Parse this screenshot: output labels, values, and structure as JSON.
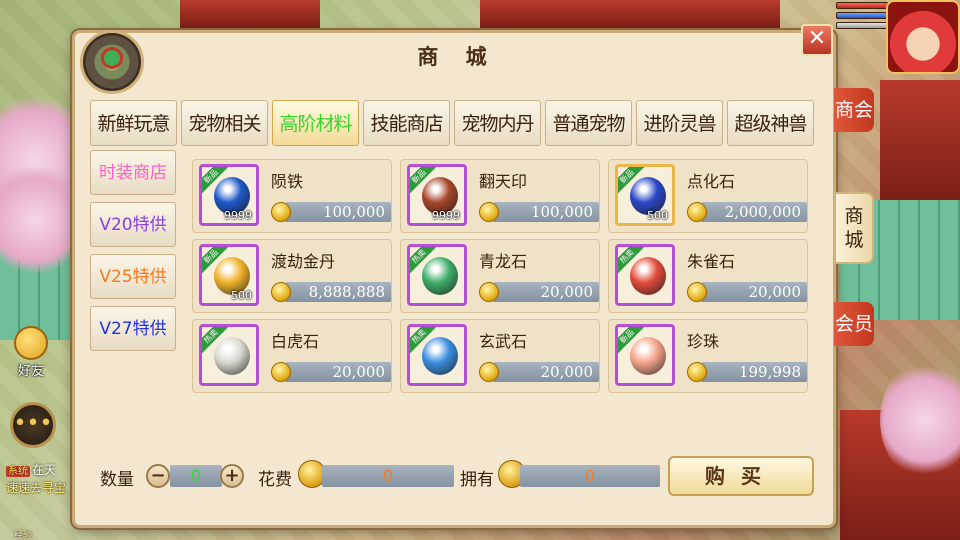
{
  "dialog": {
    "title": "商 城",
    "close_label": "✕"
  },
  "tabs": [
    {
      "label": "新鲜玩意",
      "active": false
    },
    {
      "label": "宠物相关",
      "active": false
    },
    {
      "label": "高阶材料",
      "active": true
    },
    {
      "label": "技能商店",
      "active": false
    },
    {
      "label": "宠物内丹",
      "active": false
    },
    {
      "label": "普通宠物",
      "active": false
    },
    {
      "label": "进阶灵兽",
      "active": false
    },
    {
      "label": "超级神兽",
      "active": false
    }
  ],
  "side_shops": [
    {
      "label": "时装商店",
      "color": "#ff5fc8"
    },
    {
      "label": "V20特供",
      "color": "#8a3fe0"
    },
    {
      "label": "V25特供",
      "color": "#f57a20"
    },
    {
      "label": "V27特供",
      "color": "#2033e0"
    }
  ],
  "items": [
    {
      "name": "陨铁",
      "price": "100,000",
      "count": "9999",
      "badge": "新品",
      "frame": "purple",
      "gem_color": "#1e58c8"
    },
    {
      "name": "翻天印",
      "price": "100,000",
      "count": "9999",
      "badge": "新品",
      "frame": "purple",
      "gem_color": "#a8452a"
    },
    {
      "name": "点化石",
      "price": "2,000,000",
      "count": "500",
      "badge": "新品",
      "frame": "gold",
      "gem_color": "#2a47c8"
    },
    {
      "name": "渡劫金丹",
      "price": "8,888,888",
      "count": "500",
      "badge": "新品",
      "frame": "purple",
      "gem_color": "#f0b22a"
    },
    {
      "name": "青龙石",
      "price": "20,000",
      "count": "",
      "badge": "热卖",
      "frame": "purple",
      "gem_color": "#3fae6b"
    },
    {
      "name": "朱雀石",
      "price": "20,000",
      "count": "",
      "badge": "热卖",
      "frame": "purple",
      "gem_color": "#e24c3a"
    },
    {
      "name": "白虎石",
      "price": "20,000",
      "count": "",
      "badge": "热卖",
      "frame": "purple",
      "gem_color": "#d9d9d0"
    },
    {
      "name": "玄武石",
      "price": "20,000",
      "count": "",
      "badge": "热卖",
      "frame": "purple",
      "gem_color": "#3a8ee0"
    },
    {
      "name": "珍珠",
      "price": "199,998",
      "count": "",
      "badge": "新品",
      "frame": "purple",
      "gem_color": "#f6a58a"
    }
  ],
  "bottom": {
    "qty_label": "数量",
    "qty_value": "0",
    "minus_label": "−",
    "plus_label": "+",
    "cost_label": "花费",
    "cost_value": "0",
    "own_label": "拥有",
    "own_value": "0",
    "buy_label": "购买"
  },
  "right_tabs": [
    {
      "label": "商会",
      "style": "red"
    },
    {
      "label": "商城",
      "style": "cream"
    },
    {
      "label": "会员",
      "style": "red"
    }
  ],
  "left_overlay": {
    "friend_label": "好友",
    "sys_tag": "系统",
    "sys_line1": "在天",
    "sys_line2": "速速去寻宝",
    "xp_label": "经验"
  }
}
